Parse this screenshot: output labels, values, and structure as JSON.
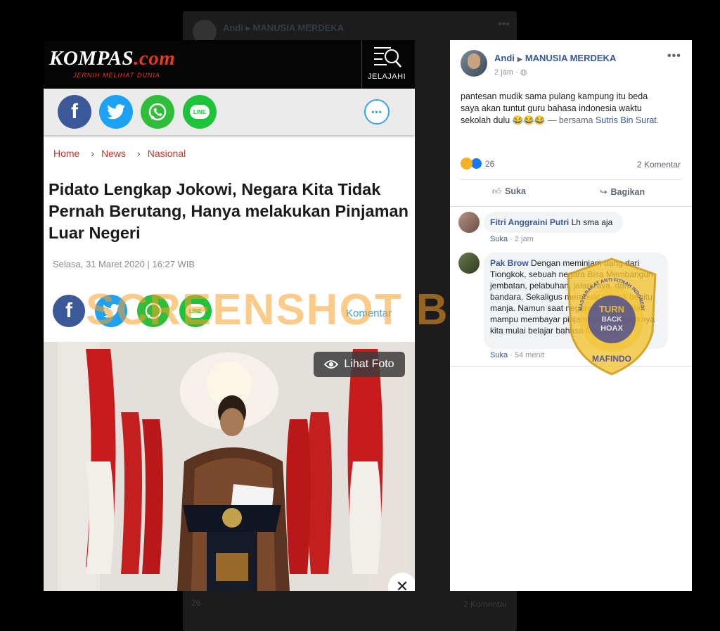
{
  "background_post": {
    "author": "Andi ▸ MANUSIA MERDEKA",
    "reaction_count": "26",
    "comment_count": "2 Komentar"
  },
  "kompas": {
    "logo_main": "KOMPAS",
    "logo_suffix": ".com",
    "tagline": "JERNIH MELIHAT DUNIA",
    "jelajahi_label": "JELAJAHI",
    "breadcrumb": [
      "Home",
      "News",
      "Nasional"
    ],
    "title": "Pidato Lengkap Jokowi, Negara Kita Tidak Pernah Berutang, Hanya melakukan Pinjaman Luar Negeri",
    "date": "Selasa, 31 Maret 2020 | 16:27 WIB",
    "komentar_label": "Komentar",
    "lihat_foto_label": "Lihat Foto",
    "share_icons": [
      "facebook-icon",
      "twitter-icon",
      "whatsapp-icon",
      "line-icon"
    ],
    "line_label": "LINE",
    "comment_icon": "chat-bubble-icon"
  },
  "watermark": "SCREENSHOT BY",
  "facebook": {
    "author": "Andi",
    "group": "MANUSIA MERDEKA",
    "time": "2 jam",
    "post_text_lines": [
      "pantesan mudik sama pulang kampung itu beda",
      "saya akan tuntut guru bahasa indonesia waktu",
      "sekolah dulu 😂😂😂"
    ],
    "with_text": "— bersama",
    "tagged": "Sutris Bin Surat.",
    "reaction_count": "26",
    "comment_count": "2 Komentar",
    "like_label": "Suka",
    "share_label": "Bagikan",
    "comments": [
      {
        "name": "Fitri Anggraini Putri",
        "text": "Lh sma aja",
        "like_label": "Suka",
        "time": "2 jam"
      },
      {
        "name": "Pak Brow",
        "text": "Dengan meminjam uang dari Tiongkok, sebuah negara Bisa Membangun jembatan, pelabuhan, jalan raya, dan bandara. Sekaligus membuat rakyak begitu manja. Namun saat negara tersebut tidak mampu membayar pinjamannya. Sebaiknya kita mulai belajar bahasa Mandarin.",
        "like_label": "Suka",
        "time": "54 menit"
      }
    ]
  },
  "seal": {
    "top_text": "MASYARAKAT ANTI FITNAH INDONESIA",
    "center_line1": "TURN",
    "center_line2": "BACK",
    "center_line3": "HOAX",
    "bottom_text": "MAFINDO"
  },
  "colors": {
    "kompas_red": "#e53a1f",
    "fb_blue": "#385898",
    "watermark_orange": "#f5a028",
    "seal_gold": "#f2c230",
    "seal_blue": "#3b3f9a"
  }
}
